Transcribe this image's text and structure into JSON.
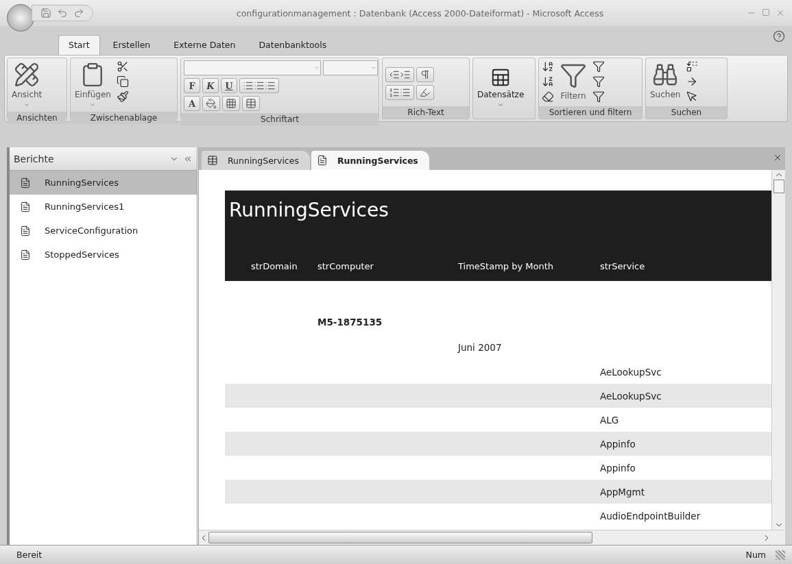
{
  "window": {
    "title": "configurationmanagement : Datenbank (Access 2000-Dateiformat) - Microsoft Access"
  },
  "ribbon_tabs": [
    {
      "label": "Start",
      "selected": true
    },
    {
      "label": "Erstellen",
      "selected": false
    },
    {
      "label": "Externe Daten",
      "selected": false
    },
    {
      "label": "Datenbanktools",
      "selected": false
    }
  ],
  "ribbon_groups": [
    {
      "kind": "views",
      "label": "Ansichten",
      "buttons": [
        "Ansicht"
      ]
    },
    {
      "kind": "clipboard",
      "label": "Zwischenablage",
      "buttons": [
        "Einfügen"
      ]
    },
    {
      "kind": "font",
      "label": "Schriftart",
      "buttons": [
        "F",
        "K",
        "U",
        "A"
      ]
    },
    {
      "kind": "richtext",
      "label": "Rich-Text"
    },
    {
      "kind": "records",
      "buttons": [
        "Datensätze"
      ]
    },
    {
      "kind": "sort",
      "label": "Sortieren und filtern",
      "buttons": [
        "Filtern"
      ]
    },
    {
      "kind": "find",
      "label": "Suchen",
      "buttons": [
        "Suchen"
      ]
    }
  ],
  "nav_pane": {
    "header": "Berichte",
    "items": [
      {
        "label": "RunningServices",
        "selected": true
      },
      {
        "label": "RunningServices1",
        "selected": false
      },
      {
        "label": "ServiceConfiguration",
        "selected": false
      },
      {
        "label": "StoppedServices",
        "selected": false
      }
    ]
  },
  "document_tabs": [
    {
      "label": "RunningServices",
      "kind": "table",
      "selected": false
    },
    {
      "label": "RunningServices",
      "kind": "report",
      "selected": true
    }
  ],
  "report": {
    "title": "RunningServices",
    "columns": [
      "strDomain",
      "strComputer",
      "TimeStamp by Month",
      "strService"
    ],
    "computer": "M5-1875135",
    "month": "Juni 2007",
    "rows": [
      {
        "service": "AeLookupSvc",
        "shaded": false
      },
      {
        "service": "AeLookupSvc",
        "shaded": true
      },
      {
        "service": "ALG",
        "shaded": false
      },
      {
        "service": "Appinfo",
        "shaded": true
      },
      {
        "service": "Appinfo",
        "shaded": false
      },
      {
        "service": "AppMgmt",
        "shaded": true
      },
      {
        "service": "AudioEndpointBuilder",
        "shaded": false
      }
    ]
  },
  "status_bar": {
    "left": "Bereit",
    "right": "Num"
  }
}
